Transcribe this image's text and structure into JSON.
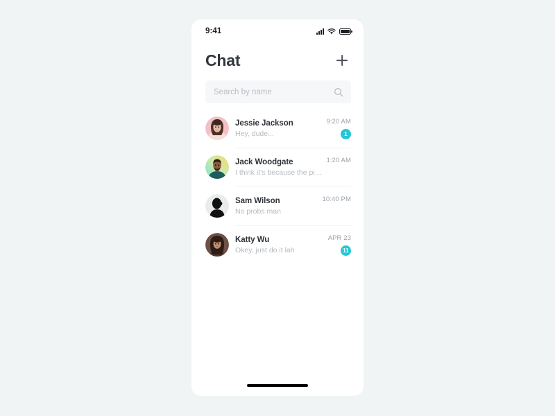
{
  "status_bar": {
    "time": "9:41",
    "icons": [
      "signal-bars-icon",
      "wifi-icon",
      "battery-icon"
    ]
  },
  "header": {
    "title": "Chat",
    "add_icon": "plus-icon"
  },
  "search": {
    "placeholder": "Search by name",
    "value": "",
    "icon": "search-icon"
  },
  "colors": {
    "badge": "#26c6d6",
    "page_background": "#f1f4f5",
    "card_background": "#ffffff",
    "title": "#33373f",
    "preview_text": "#b4babf",
    "time_text": "#9aa1a8",
    "divider": "#f2f3f4"
  },
  "chats": [
    {
      "name": "Jessie Jackson",
      "preview": "Hey, dude...",
      "time": "9:20 AM",
      "badge": "1",
      "avatar": "avatar-jessie-jackson"
    },
    {
      "name": "Jack Woodgate",
      "preview": "I think it's because the pixels...",
      "time": "1:20 AM",
      "badge": "",
      "avatar": "avatar-jack-woodgate"
    },
    {
      "name": "Sam Wilson",
      "preview": "No probs man",
      "time": "10:40 PM",
      "badge": "",
      "avatar": "avatar-sam-wilson"
    },
    {
      "name": "Katty Wu",
      "preview": "Okey, just do it lah",
      "time": "APR 23",
      "badge": "11",
      "avatar": "avatar-katty-wu"
    }
  ],
  "home_indicator": "home-indicator-bar"
}
